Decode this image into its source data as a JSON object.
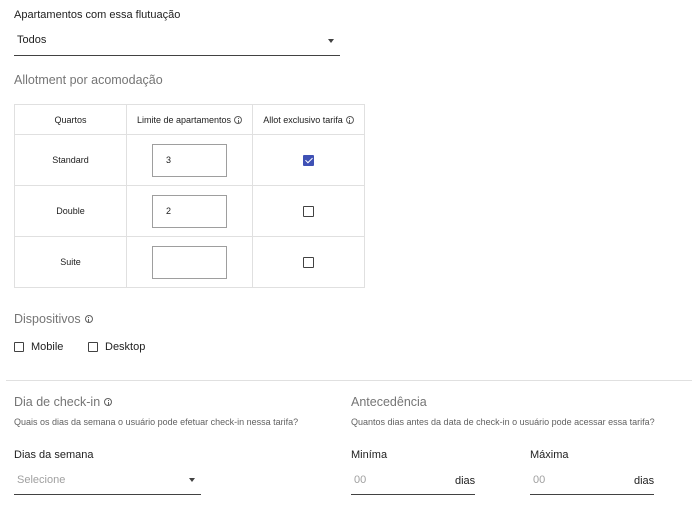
{
  "flutuacao": {
    "label": "Apartamentos com essa flutuação",
    "value": "Todos"
  },
  "allotment": {
    "title": "Allotment por acomodação",
    "headers": [
      "Quartos",
      "Limite de apartamentos",
      "Allot exclusivo tarifa"
    ],
    "rows": [
      {
        "room": "Standard",
        "limit": "3",
        "exclusive": true
      },
      {
        "room": "Double",
        "limit": "2",
        "exclusive": false
      },
      {
        "room": "Suite",
        "limit": "",
        "exclusive": false
      }
    ]
  },
  "dispositivos": {
    "title": "Dispositivos",
    "options": [
      {
        "label": "Mobile",
        "checked": false
      },
      {
        "label": "Desktop",
        "checked": false
      }
    ]
  },
  "checkin": {
    "title": "Dia de check-in",
    "hint": "Quais os dias da semana o usuário pode efetuar check-in nessa tarifa?",
    "field_label": "Dias da semana",
    "placeholder": "Selecione"
  },
  "antecedencia": {
    "title": "Antecedência",
    "hint": "Quantos dias antes da data de check-in o usuário pode acessar essa tarifa?",
    "min_label": "Miníma",
    "max_label": "Máxima",
    "min_placeholder": "00",
    "max_placeholder": "00",
    "suffix": "dias"
  },
  "colors": {
    "accent": "#3f51b5",
    "border": "#e0e0e0",
    "text": "#212121",
    "muted": "#757575"
  },
  "icons": [
    "info-icon",
    "dropdown-arrow-icon",
    "checkbox-icon"
  ]
}
